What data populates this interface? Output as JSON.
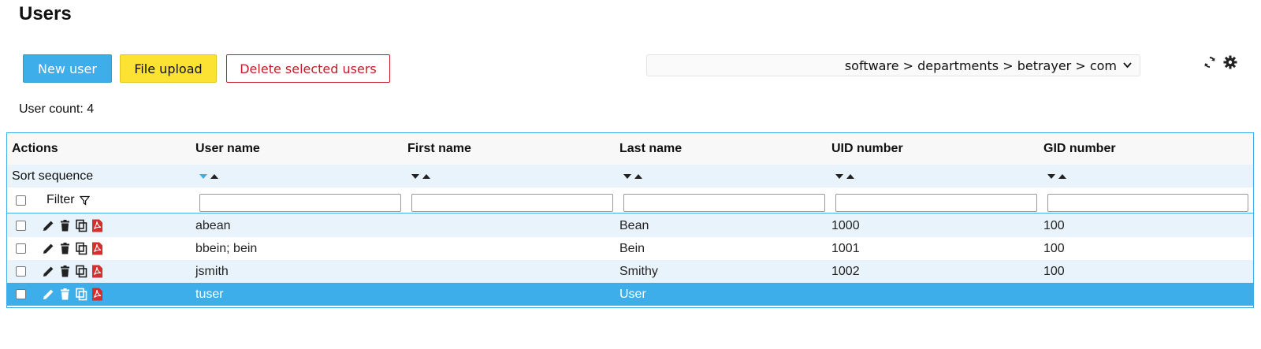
{
  "page_title": "Users",
  "toolbar": {
    "new_user_label": "New user",
    "file_upload_label": "File upload",
    "delete_selected_label": "Delete selected users"
  },
  "ou_select": {
    "value": "software > departments > betrayer > com"
  },
  "icons": {
    "refresh": "refresh-icon",
    "settings": "gear-icon"
  },
  "user_count": {
    "label": "User count:",
    "value": "4"
  },
  "table": {
    "headers": [
      "Actions",
      "User name",
      "First name",
      "Last name",
      "UID number",
      "GID number"
    ],
    "sort_label": "Sort sequence",
    "filter_label": "Filter",
    "rows": [
      {
        "user_name": "abean",
        "first_name": "",
        "last_name": "Bean",
        "uid": "1000",
        "gid": "100"
      },
      {
        "user_name": "bbein; bein",
        "first_name": "",
        "last_name": "Bein",
        "uid": "1001",
        "gid": "100"
      },
      {
        "user_name": "jsmith",
        "first_name": "",
        "last_name": "Smithy",
        "uid": "1002",
        "gid": "100"
      },
      {
        "user_name": "tuser",
        "first_name": "",
        "last_name": "User",
        "uid": "",
        "gid": ""
      }
    ]
  },
  "colors": {
    "accent": "#3daee9",
    "yellow": "#fbe233",
    "danger": "#c01c28",
    "pdf": "#d32f2f"
  }
}
